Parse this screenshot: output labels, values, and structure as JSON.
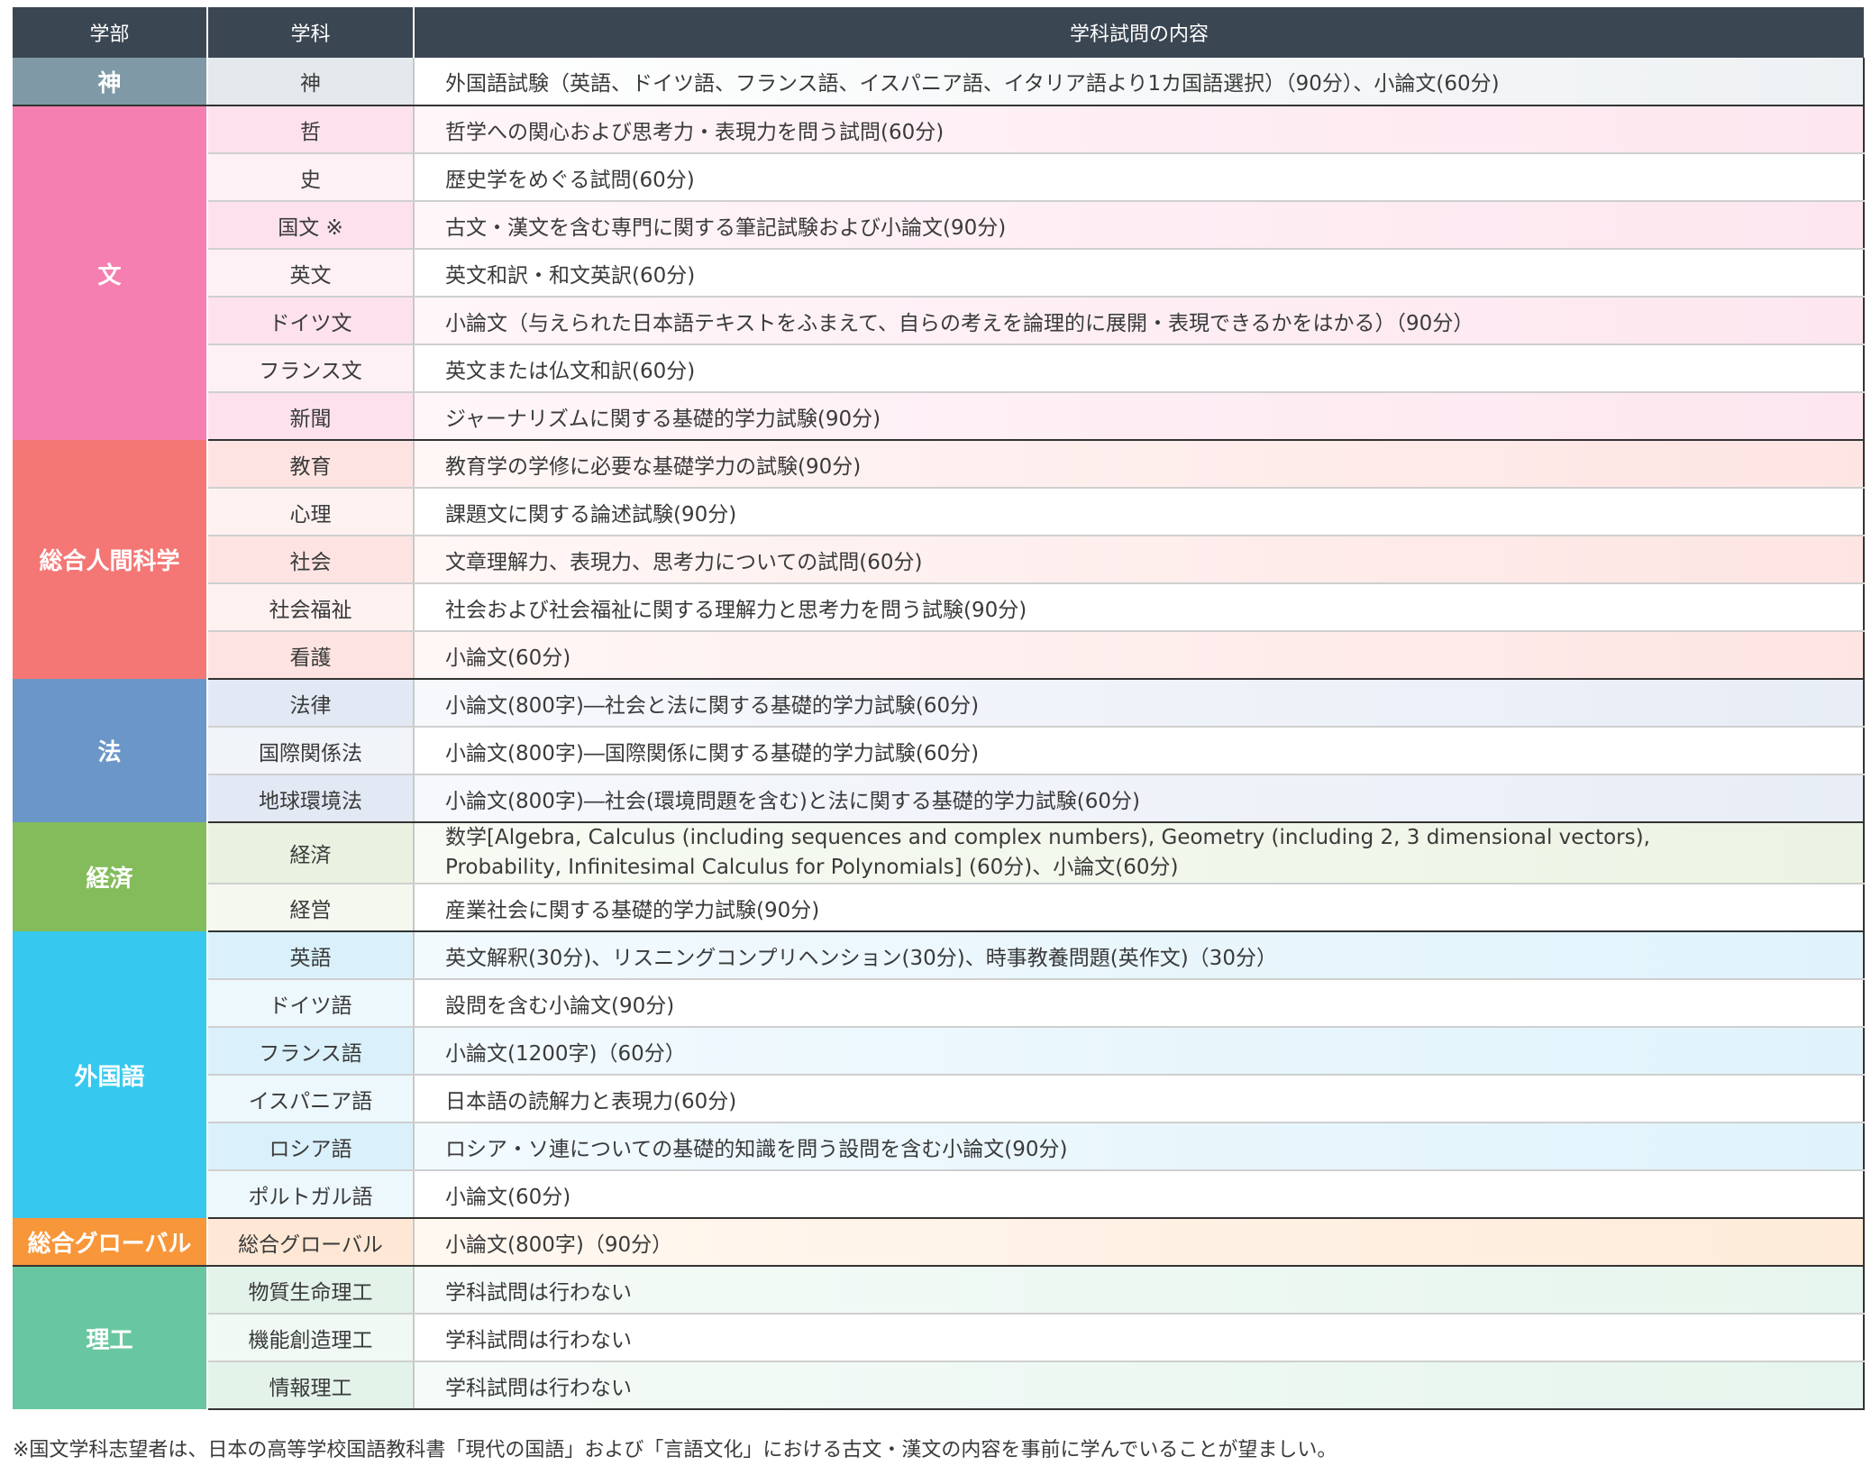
{
  "headers": {
    "faculty": "学部",
    "department": "学科",
    "content": "学科試問の内容"
  },
  "groups": [
    {
      "faculty": "神",
      "rows": [
        {
          "dept": "神",
          "content": "外国語試験（英語、ドイツ語、フランス語、イスパニア語、イタリア語より1カ国語選択）（90分）、小論文(60分)"
        }
      ]
    },
    {
      "faculty": "文",
      "rows": [
        {
          "dept": "哲",
          "content": "哲学への関心および思考力・表現力を問う試問(60分)"
        },
        {
          "dept": "史",
          "content": "歴史学をめぐる試問(60分)"
        },
        {
          "dept": "国文 ※",
          "content": "古文・漢文を含む専門に関する筆記試験および小論文(90分)"
        },
        {
          "dept": "英文",
          "content": "英文和訳・和文英訳(60分)"
        },
        {
          "dept": "ドイツ文",
          "content": "小論文（与えられた日本語テキストをふまえて、自らの考えを論理的に展開・表現できるかをはかる）（90分）"
        },
        {
          "dept": "フランス文",
          "content": "英文または仏文和訳(60分)"
        },
        {
          "dept": "新聞",
          "content": "ジャーナリズムに関する基礎的学力試験(90分)"
        }
      ]
    },
    {
      "faculty": "総合人間科学",
      "rows": [
        {
          "dept": "教育",
          "content": "教育学の学修に必要な基礎学力の試験(90分)"
        },
        {
          "dept": "心理",
          "content": "課題文に関する論述試験(90分)"
        },
        {
          "dept": "社会",
          "content": "文章理解力、表現力、思考力についての試問(60分)"
        },
        {
          "dept": "社会福祉",
          "content": "社会および社会福祉に関する理解力と思考力を問う試験(90分)"
        },
        {
          "dept": "看護",
          "content": "小論文(60分)"
        }
      ]
    },
    {
      "faculty": "法",
      "rows": [
        {
          "dept": "法律",
          "content": "小論文(800字)―社会と法に関する基礎的学力試験(60分)"
        },
        {
          "dept": "国際関係法",
          "content": "小論文(800字)―国際関係に関する基礎的学力試験(60分)"
        },
        {
          "dept": "地球環境法",
          "content": "小論文(800字)―社会(環境問題を含む)と法に関する基礎的学力試験(60分)"
        }
      ]
    },
    {
      "faculty": "経済",
      "rows": [
        {
          "dept": "経済",
          "content_line1": "数学[Algebra, Calculus (including sequences and complex numbers), Geometry (including 2, 3 dimensional vectors),",
          "content_line2": "Probability, Infinitesimal Calculus for Polynomials] (60分)、小論文(60分)"
        },
        {
          "dept": "経営",
          "content": "産業社会に関する基礎的学力試験(90分)"
        }
      ]
    },
    {
      "faculty": "外国語",
      "rows": [
        {
          "dept": "英語",
          "content": "英文解釈(30分)、リスニングコンプリヘンション(30分)、時事教養問題(英作文)（30分）"
        },
        {
          "dept": "ドイツ語",
          "content": "設問を含む小論文(90分)"
        },
        {
          "dept": "フランス語",
          "content": "小論文(1200字)（60分）"
        },
        {
          "dept": "イスパニア語",
          "content": "日本語の読解力と表現力(60分)"
        },
        {
          "dept": "ロシア語",
          "content": "ロシア・ソ連についての基礎的知識を問う設問を含む小論文(90分)"
        },
        {
          "dept": "ポルトガル語",
          "content": "小論文(60分)"
        }
      ]
    },
    {
      "faculty": "総合グローバル",
      "rows": [
        {
          "dept": "総合グローバル",
          "content": "小論文(800字)（90分）"
        }
      ]
    },
    {
      "faculty": "理工",
      "rows": [
        {
          "dept": "物質生命理工",
          "content": "学科試問は行わない"
        },
        {
          "dept": "機能創造理工",
          "content": "学科試問は行わない"
        },
        {
          "dept": "情報理工",
          "content": "学科試問は行わない"
        }
      ]
    }
  ],
  "footnote": "※国文学科志望者は、日本の高等学校国語教科書「現代の国語」および「言語文化」における古文・漢文の内容を事前に学んでいることが望ましい。"
}
